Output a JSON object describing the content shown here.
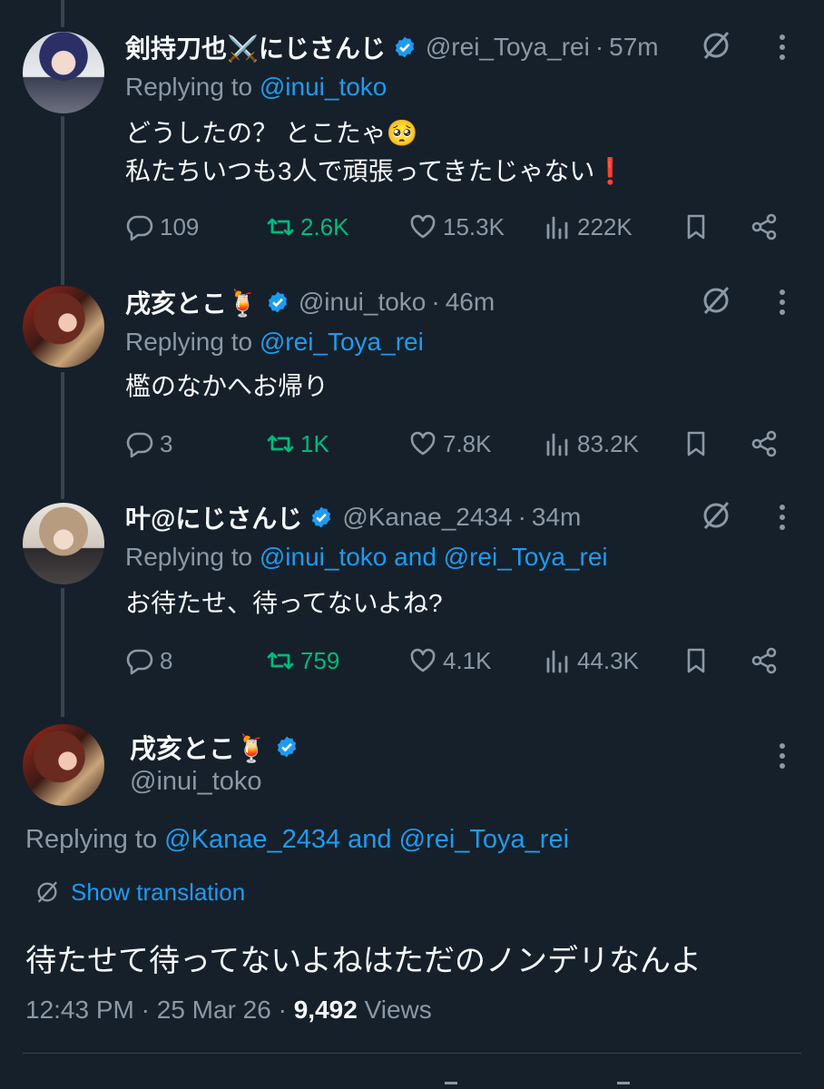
{
  "colors": {
    "background": "#15202b",
    "text": "#f7f9f9",
    "muted": "#8b98a5",
    "link": "#1d9bf0",
    "retweet": "#00ba7c",
    "verified": "#1d9bf0",
    "thread_line": "#38444d"
  },
  "tweets": [
    {
      "display_name": "剣持刀也⚔️にじさんじ",
      "handle": "@rei_Toya_rei",
      "separator": "·",
      "time": "57m",
      "replying_prefix": "Replying to",
      "replying_links": [
        "@inui_toko"
      ],
      "text": "どうしたの？ とこたゃ🥺\n私たちいつも3人で頑張ってきたじゃない❗",
      "replies": "109",
      "retweets": "2.6K",
      "likes": "15.3K",
      "views": "222K"
    },
    {
      "display_name": "戌亥とこ🍹",
      "handle": "@inui_toko",
      "separator": "·",
      "time": "46m",
      "replying_prefix": "Replying to",
      "replying_links": [
        "@rei_Toya_rei"
      ],
      "text": "檻のなかへお帰り",
      "replies": "3",
      "retweets": "1K",
      "likes": "7.8K",
      "views": "83.2K"
    },
    {
      "display_name": "叶@にじさんじ",
      "handle": "@Kanae_2434",
      "separator": "·",
      "time": "34m",
      "replying_prefix": "Replying to",
      "replying_links": [
        "@inui_toko",
        "@rei_Toya_rei"
      ],
      "replying_joiner": "and",
      "text": "お待たせ、待ってないよね?",
      "replies": "8",
      "retweets": "759",
      "likes": "4.1K",
      "views": "44.3K"
    }
  ],
  "main_tweet": {
    "display_name": "戌亥とこ🍹",
    "handle": "@inui_toko",
    "replying_prefix": "Replying to",
    "replying_links": [
      "@Kanae_2434",
      "@rei_Toya_rei"
    ],
    "replying_joiner": "and",
    "show_translation": "Show translation",
    "text": "待たせて待ってないよねはただのノンデリなんよ",
    "time": "12:43 PM",
    "date": "25 Mar 26",
    "separator": "·",
    "views_count": "9,492",
    "views_label": "Views"
  }
}
